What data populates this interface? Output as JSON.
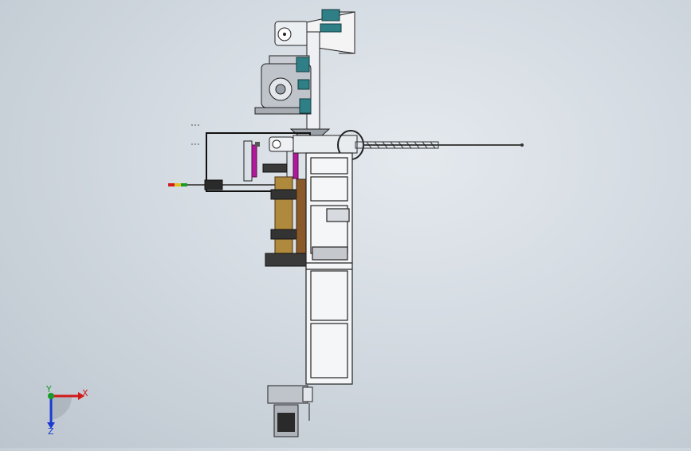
{
  "viewport": {
    "background_top": "#e4e9ee",
    "background_bottom": "#bcc5ce"
  },
  "triad": {
    "x_label": "X",
    "y_label": "Y",
    "z_label": "Z",
    "x_color": "#d21a1a",
    "y_color": "#1a9a2a",
    "z_color": "#1a3ad2"
  },
  "model": {
    "frame_color": "#f2f2f2",
    "motor_color": "#c8ccd2",
    "accent_teal": "#2f7f86",
    "accent_brown": "#8b5a2b",
    "accent_gold": "#b08a3c",
    "accent_magenta": "#b01a9a",
    "dark": "#2a2a2a"
  }
}
